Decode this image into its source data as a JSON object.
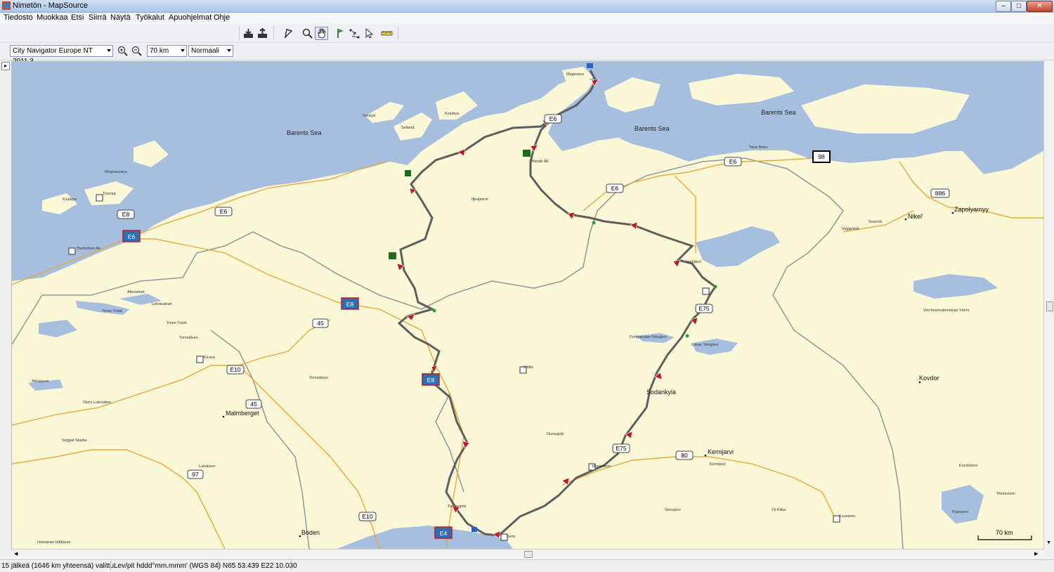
{
  "window": {
    "title": "Nimetön - MapSource"
  },
  "menu": [
    "Tiedosto",
    "Muokkaa",
    "Etsi",
    "Siirrä",
    "Näytä",
    "Työkalut",
    "Apuohjelmat",
    "Ohje"
  ],
  "toolbar2": {
    "map_product": "City Navigator Europe NT 2011.3",
    "zoom_level": "70 km",
    "detail": "Normaali"
  },
  "map": {
    "seas": [
      "Barents Sea",
      "Barents Sea",
      "Barents Sea"
    ],
    "rivers": [
      "Tana River"
    ],
    "cities": [
      "Malmberget",
      "Boden",
      "Kemijarvi",
      "Kovdor",
      "Nikel'",
      "Zapolyarnyy",
      "Sodankyla",
      "Torneälven",
      "Kemijärvi"
    ],
    "small_places": [
      "Magerøya",
      "Sørøya",
      "Seiland",
      "Kvaløya",
      "Ringvassøya",
      "Tromsø",
      "Kvaløya",
      "Bardufoss Ab",
      "Altevatnet",
      "Leinavatnet",
      "Torne-Träsk",
      "Torne Träsk",
      "Torneälven",
      "Kiruna",
      "Akkajaure",
      "Stora Lulevatten",
      "Saggat Skalka",
      "Luleälven",
      "Hornavan Uddjaure",
      "Banak Ab",
      "Ifjesjavrre",
      "Vaggetem",
      "Svanvik",
      "Inarijärvi",
      "Portipahdan Tekojärvi",
      "Lokan Tekojärvi",
      "Kittila",
      "Ounasjoki",
      "Rovaniemi",
      "Tornionjoki",
      "Simojärvi",
      "Yli-Kitka",
      "Kuusamo",
      "Pyaozero",
      "Verchnemulomskoje Vdchr",
      "Kovdozero",
      "Tikshozero",
      "Kemi",
      "Tana River"
    ],
    "road_shields": [
      "E6",
      "E8",
      "E6",
      "E6",
      "E6",
      "E8",
      "45",
      "E10",
      "45",
      "97",
      "E10",
      "E4",
      "E8",
      "E75",
      "E75",
      "80",
      "98",
      "886",
      "E6"
    ],
    "scale": "70 km"
  },
  "status": {
    "selection": "15 jälkeä (1646 km yhteensä) valittu",
    "format": "Lev/pit hddd°mm.mmm' (WGS 84)",
    "position": "N65 53.439 E22 10.030"
  },
  "colors": {
    "sea": "#a7bfdf",
    "land": "#fbf8d8",
    "route": "#5e5e5e",
    "road": "#e8a83a",
    "border": "#9a9a9a",
    "waypoint": "#c0181e"
  }
}
